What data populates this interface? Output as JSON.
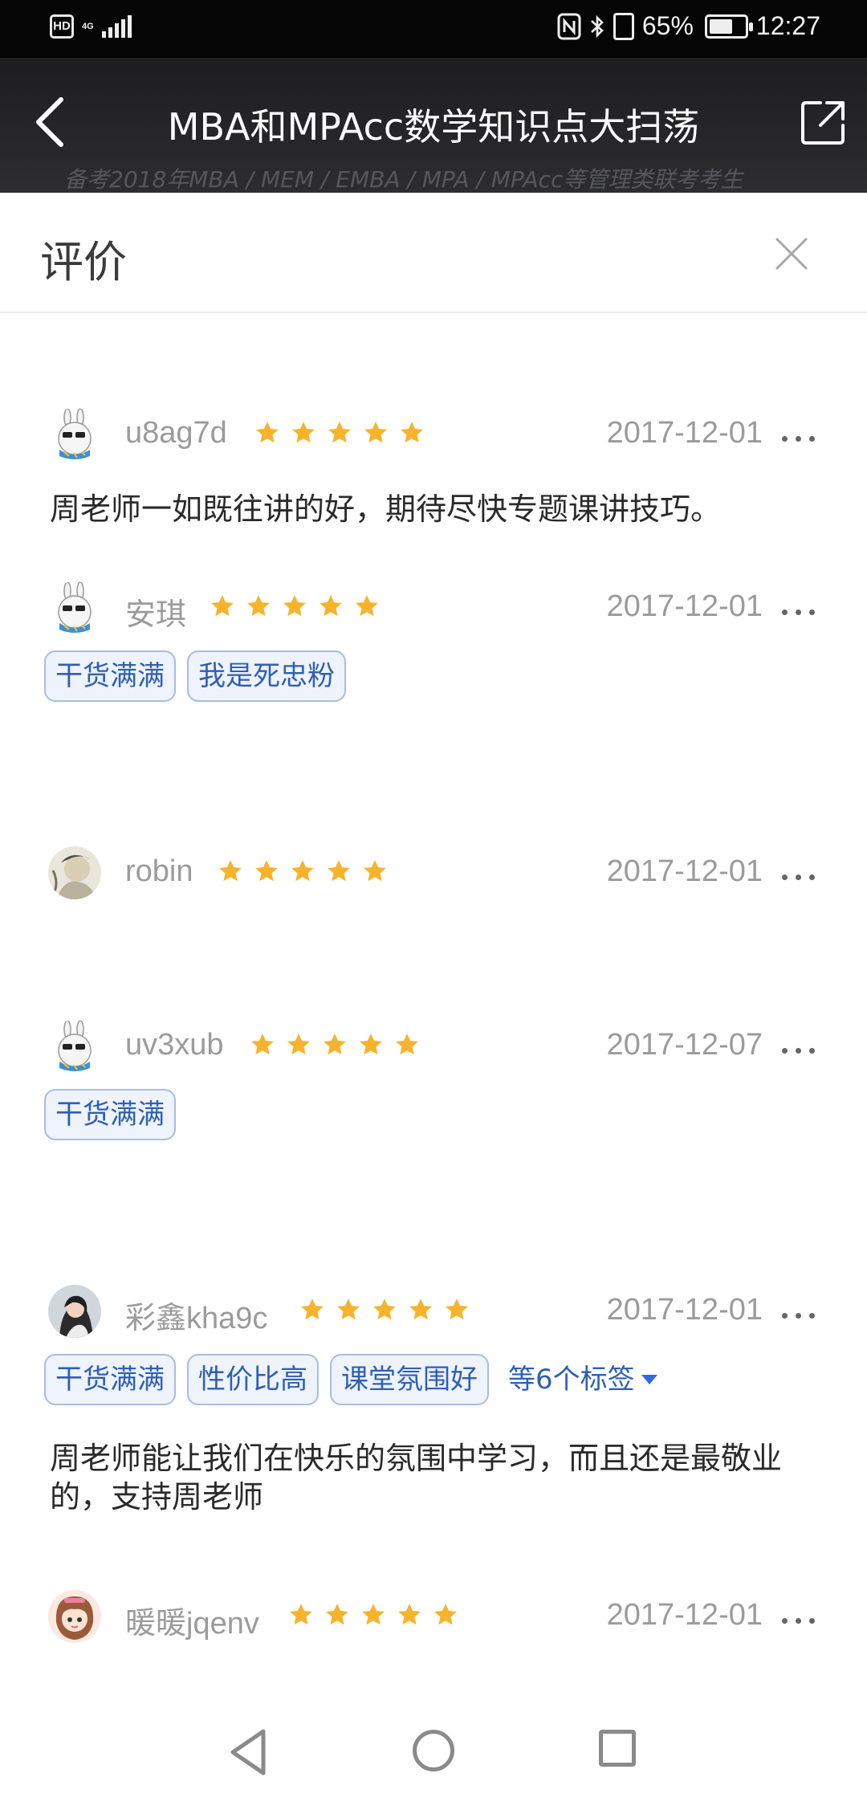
{
  "status_bar": {
    "network": "4G",
    "battery": "65%",
    "time": "12:27"
  },
  "header": {
    "title": "MBA和MPAcc数学知识点大扫荡",
    "subtitle_behind": "备考2018年MBA / MEM / EMBA / MPA / MPAcc等管理类联考考生"
  },
  "sheet": {
    "title": "评价"
  },
  "reviews": [
    {
      "user": "u8ag7d",
      "rating": 5,
      "date": "2017-12-01",
      "tags": [],
      "text": "周老师一如既往讲的好，期待尽快专题课讲技巧。"
    },
    {
      "user": "安琪",
      "rating": 5,
      "date": "2017-12-01",
      "tags": [
        "干货满满",
        "我是死忠粉"
      ],
      "text": ""
    },
    {
      "user": "robin",
      "rating": 5,
      "date": "2017-12-01",
      "tags": [],
      "text": ""
    },
    {
      "user": "uv3xub",
      "rating": 5,
      "date": "2017-12-07",
      "tags": [
        "干货满满"
      ],
      "text": ""
    },
    {
      "user": "彩鑫kha9c",
      "rating": 5,
      "date": "2017-12-01",
      "tags": [
        "干货满满",
        "性价比高",
        "课堂氛围好"
      ],
      "tags_more": "等6个标签",
      "text": "周老师能让我们在快乐的氛围中学习，而且还是最敬业的，支持周老师"
    },
    {
      "user": "暖暖jqenv",
      "rating": 5,
      "date": "2017-12-01",
      "tags": [],
      "text": ""
    }
  ],
  "colors": {
    "star": "#f7b32b",
    "tag_text": "#2e5fb3",
    "tag_border": "#a9bde0",
    "tag_bg": "#eef3fc",
    "meta_gray": "#9b9b9b"
  },
  "icons": {
    "back": "chevron-left-icon",
    "share": "share-icon",
    "close": "close-icon",
    "more": "more-horizontal-icon",
    "nav_back": "triangle-back-icon",
    "nav_home": "circle-home-icon",
    "nav_recent": "square-recent-icon"
  }
}
